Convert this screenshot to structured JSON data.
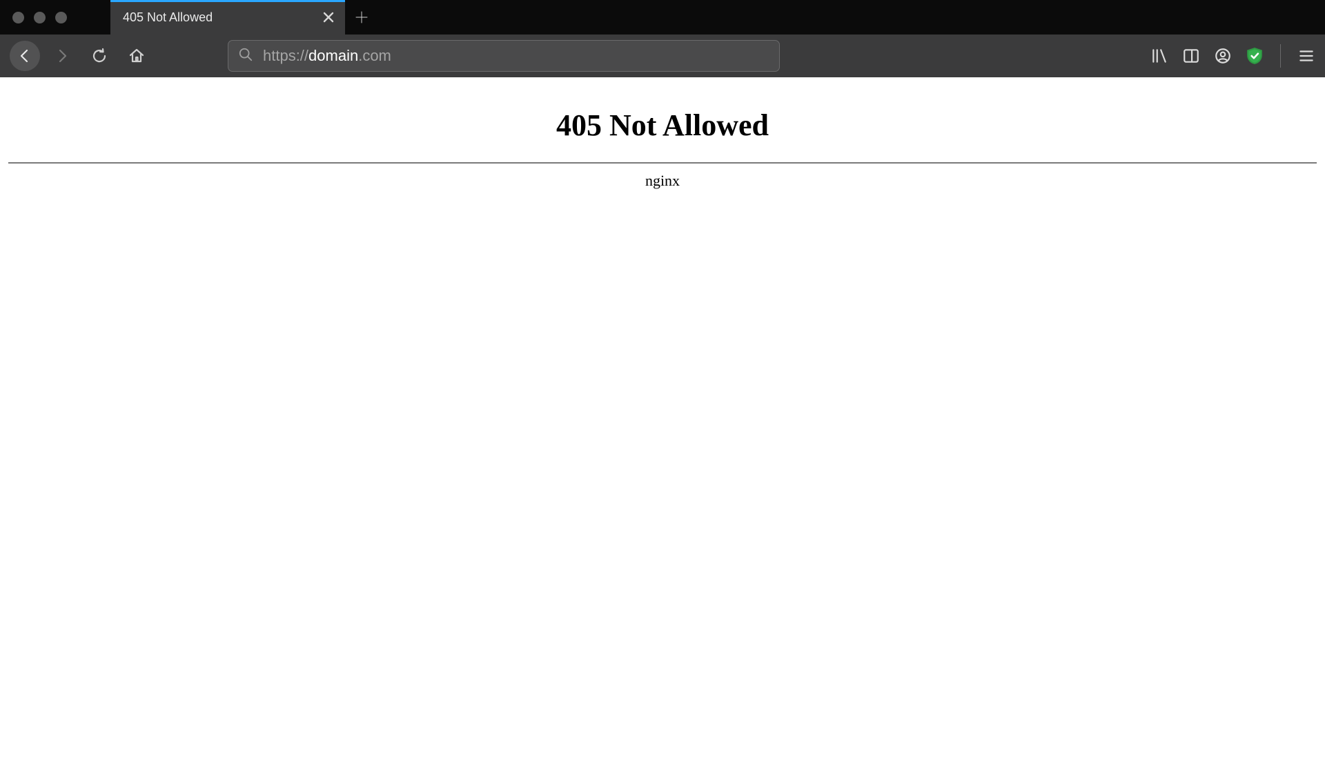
{
  "tab": {
    "title": "405 Not Allowed"
  },
  "address": {
    "protocol": "https://",
    "host": "domain",
    "tld": ".com"
  },
  "page": {
    "heading": "405 Not Allowed",
    "server": "nginx"
  }
}
